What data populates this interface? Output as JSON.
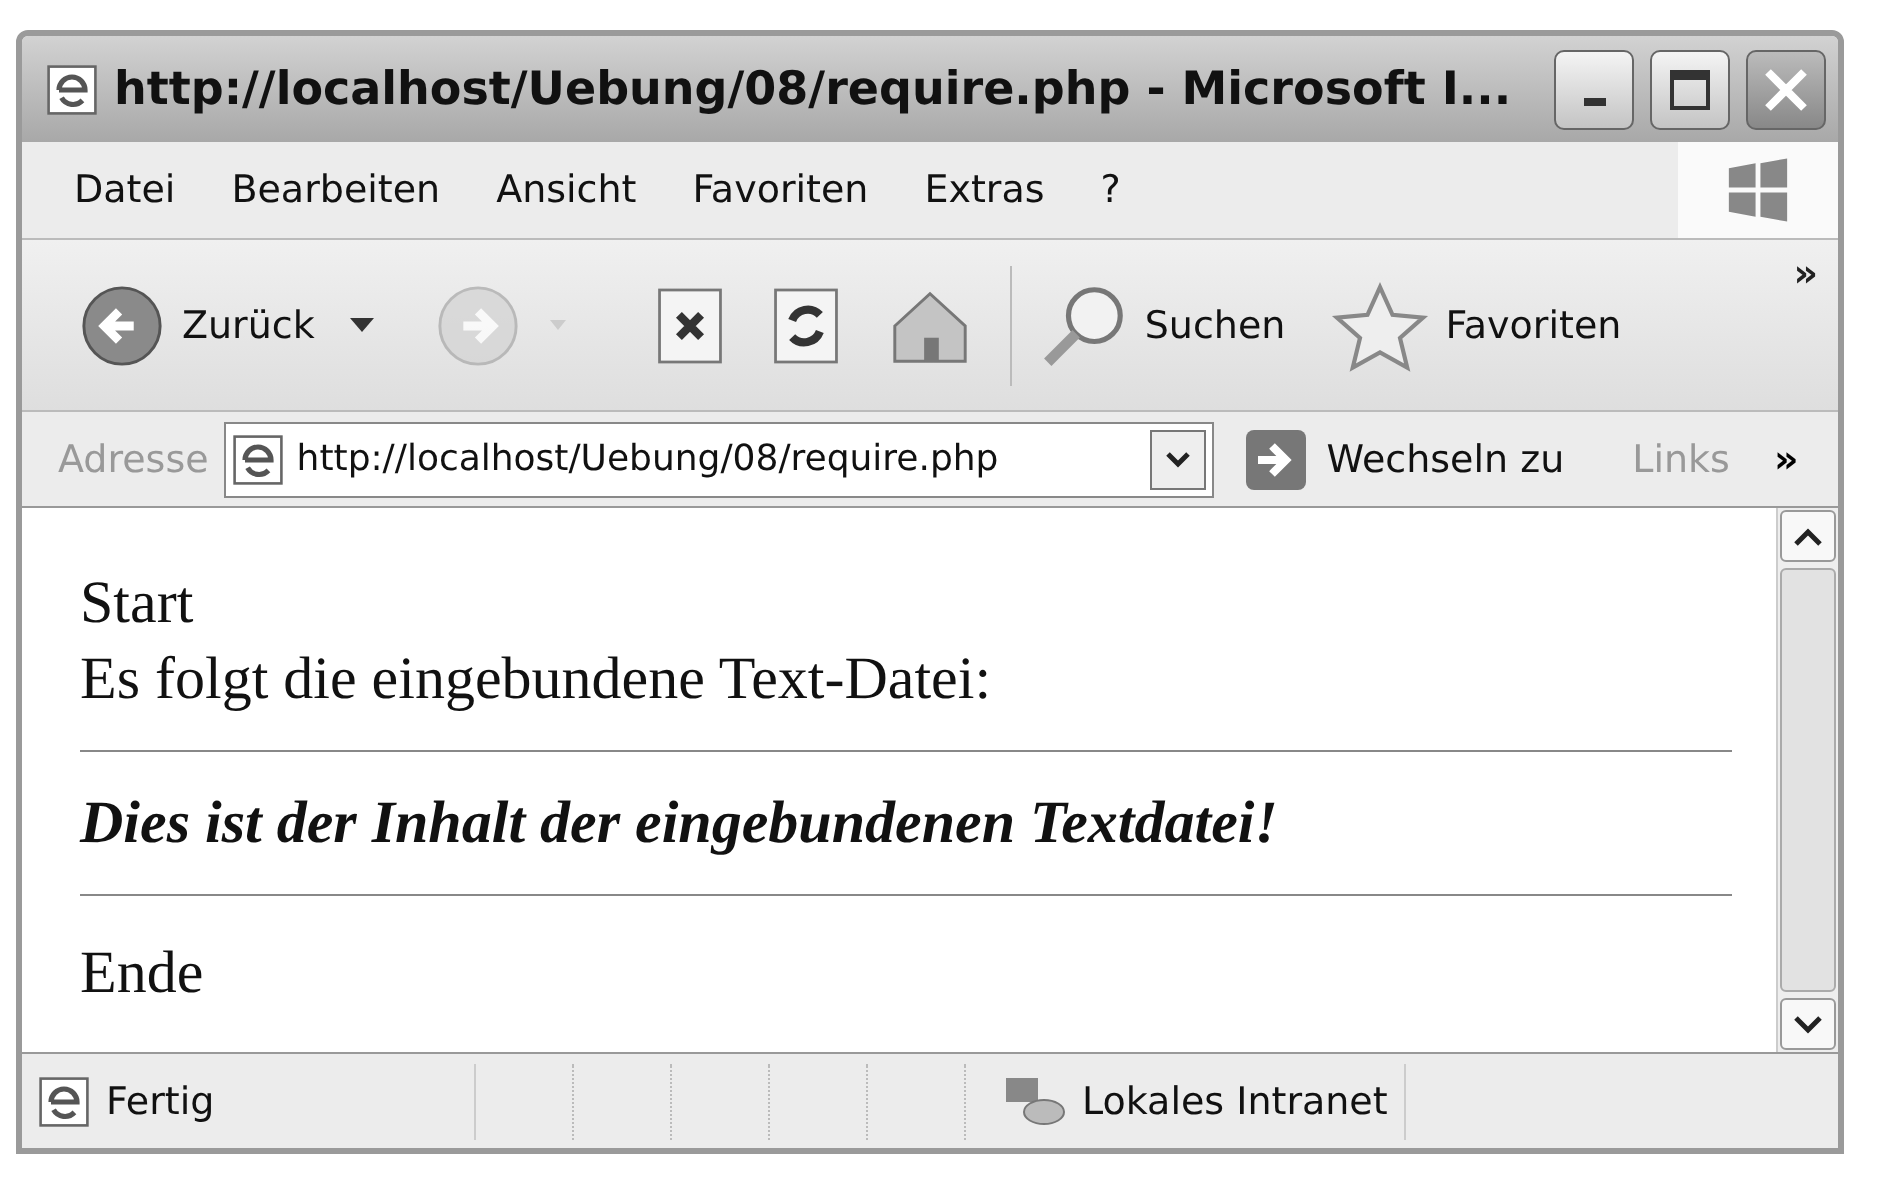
{
  "window": {
    "title": "http://localhost/Uebung/08/require.php - Microsoft I..."
  },
  "menu": [
    "Datei",
    "Bearbeiten",
    "Ansicht",
    "Favoriten",
    "Extras",
    "?"
  ],
  "toolbar": {
    "buttons": [
      {
        "kind": "back",
        "label": "Zurück",
        "disabled": false
      },
      {
        "kind": "forward",
        "disabled": true
      },
      {
        "kind": "stop",
        "disabled": false
      },
      {
        "kind": "refresh",
        "disabled": false
      },
      {
        "kind": "home",
        "disabled": false
      },
      {
        "kind": "search",
        "label": "Suchen",
        "disabled": false
      },
      {
        "kind": "favorites",
        "label": "Favoriten",
        "disabled": false
      }
    ],
    "overflow": "»"
  },
  "address_bar": {
    "label": "Adresse",
    "value": "http://localhost/Uebung/08/require.php",
    "go_label": "Wechseln zu",
    "links_label": "Links",
    "overflow": "»"
  },
  "content": [
    {
      "kind": "text",
      "text": "Start"
    },
    {
      "kind": "text",
      "text": "Es folgt die eingebundene Text-Datei:"
    },
    {
      "kind": "rule"
    },
    {
      "kind": "emphasis",
      "text": "Dies ist der Inhalt der eingebundenen Textdatei!"
    },
    {
      "kind": "rule"
    },
    {
      "kind": "text",
      "text": "Ende"
    }
  ],
  "status_bar": {
    "status": "Fertig",
    "zone": "Lokales Intranet"
  }
}
